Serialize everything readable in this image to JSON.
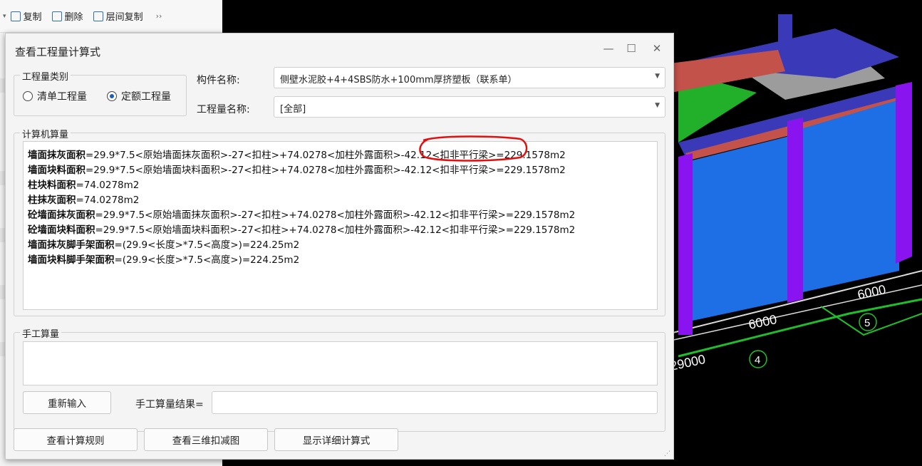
{
  "toolbar": {
    "copy_label": "复制",
    "delete_label": "删除",
    "floor_copy_label": "层间复制",
    "more_label": "››"
  },
  "dialog": {
    "title": "查看工程量计算式",
    "category_group": {
      "title": "工程量类别",
      "options": [
        "清单工程量",
        "定额工程量"
      ],
      "selected": "定额工程量"
    },
    "component_label": "构件名称:",
    "component_value": "侧壁水泥胶+4+4SBS防水+100mm厚挤塑板（联系单）",
    "quantity_label": "工程量名称:",
    "quantity_value": "[全部]",
    "computer_group_title": "计算机算量",
    "calc_lines": [
      {
        "name": "墙面抹灰面积",
        "expr": "=29.9*7.5<原始墙面抹灰面积>-27<扣柱>+74.0278<加柱外露面积>-42.12<扣非平行梁>=229.1578m2"
      },
      {
        "name": "墙面块料面积",
        "expr": "=29.9*7.5<原始墙面块料面积>-27<扣柱>+74.0278<加柱外露面积>-42.12<扣非平行梁>=229.1578m2"
      },
      {
        "name": "柱块料面积",
        "expr": "=74.0278m2"
      },
      {
        "name": "柱抹灰面积",
        "expr": "=74.0278m2"
      },
      {
        "name": "砼墙面抹灰面积",
        "expr": "=29.9*7.5<原始墙面抹灰面积>-27<扣柱>+74.0278<加柱外露面积>-42.12<扣非平行梁>=229.1578m2"
      },
      {
        "name": "砼墙面块料面积",
        "expr": "=29.9*7.5<原始墙面块料面积>-27<扣柱>+74.0278<加柱外露面积>-42.12<扣非平行梁>=229.1578m2"
      },
      {
        "name": "墙面抹灰脚手架面积",
        "expr": "=(29.9<长度>*7.5<高度>)=224.25m2"
      },
      {
        "name": "墙面块料脚手架面积",
        "expr": "=(29.9<长度>*7.5<高度>)=224.25m2"
      }
    ],
    "manual_group_title": "手工算量",
    "reenter_button": "重新输入",
    "manual_result_label": "手工算量结果=",
    "manual_result_value": "",
    "buttons": {
      "view_rules": "查看计算规则",
      "view_3d": "查看三维扣减图",
      "show_detail": "显示详细计算式"
    }
  },
  "viewport": {
    "dims": [
      "6000",
      "6000",
      "29000"
    ],
    "axis_marks": [
      "4",
      "5"
    ],
    "colors": {
      "wall": "#1e6fe6",
      "column": "#8a14f0",
      "beam_top": "#3a3ab8",
      "beam_red": "#c2524a",
      "slab": "#22b02a"
    }
  },
  "annotation": {
    "color": "#e01010"
  }
}
